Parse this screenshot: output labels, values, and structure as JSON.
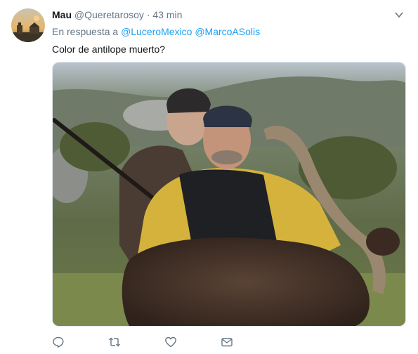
{
  "tweet": {
    "display_name": "Mau",
    "handle": "@Queretarosoy",
    "separator": "·",
    "time": "43 min",
    "reply_prefix": "En respuesta a",
    "reply_mentions": [
      "@LuceroMexico",
      "@MarcoASolis"
    ],
    "text": "Color de antilope muerto?",
    "media": {
      "description_icon": "photo"
    },
    "actions": [
      {
        "name": "reply",
        "icon": "reply-icon"
      },
      {
        "name": "retweet",
        "icon": "retweet-icon"
      },
      {
        "name": "like",
        "icon": "heart-icon"
      },
      {
        "name": "message",
        "icon": "envelope-icon"
      }
    ]
  },
  "colors": {
    "text_primary": "#14171a",
    "text_secondary": "#657786",
    "link": "#1da1f2",
    "border": "#e1e8ed"
  }
}
